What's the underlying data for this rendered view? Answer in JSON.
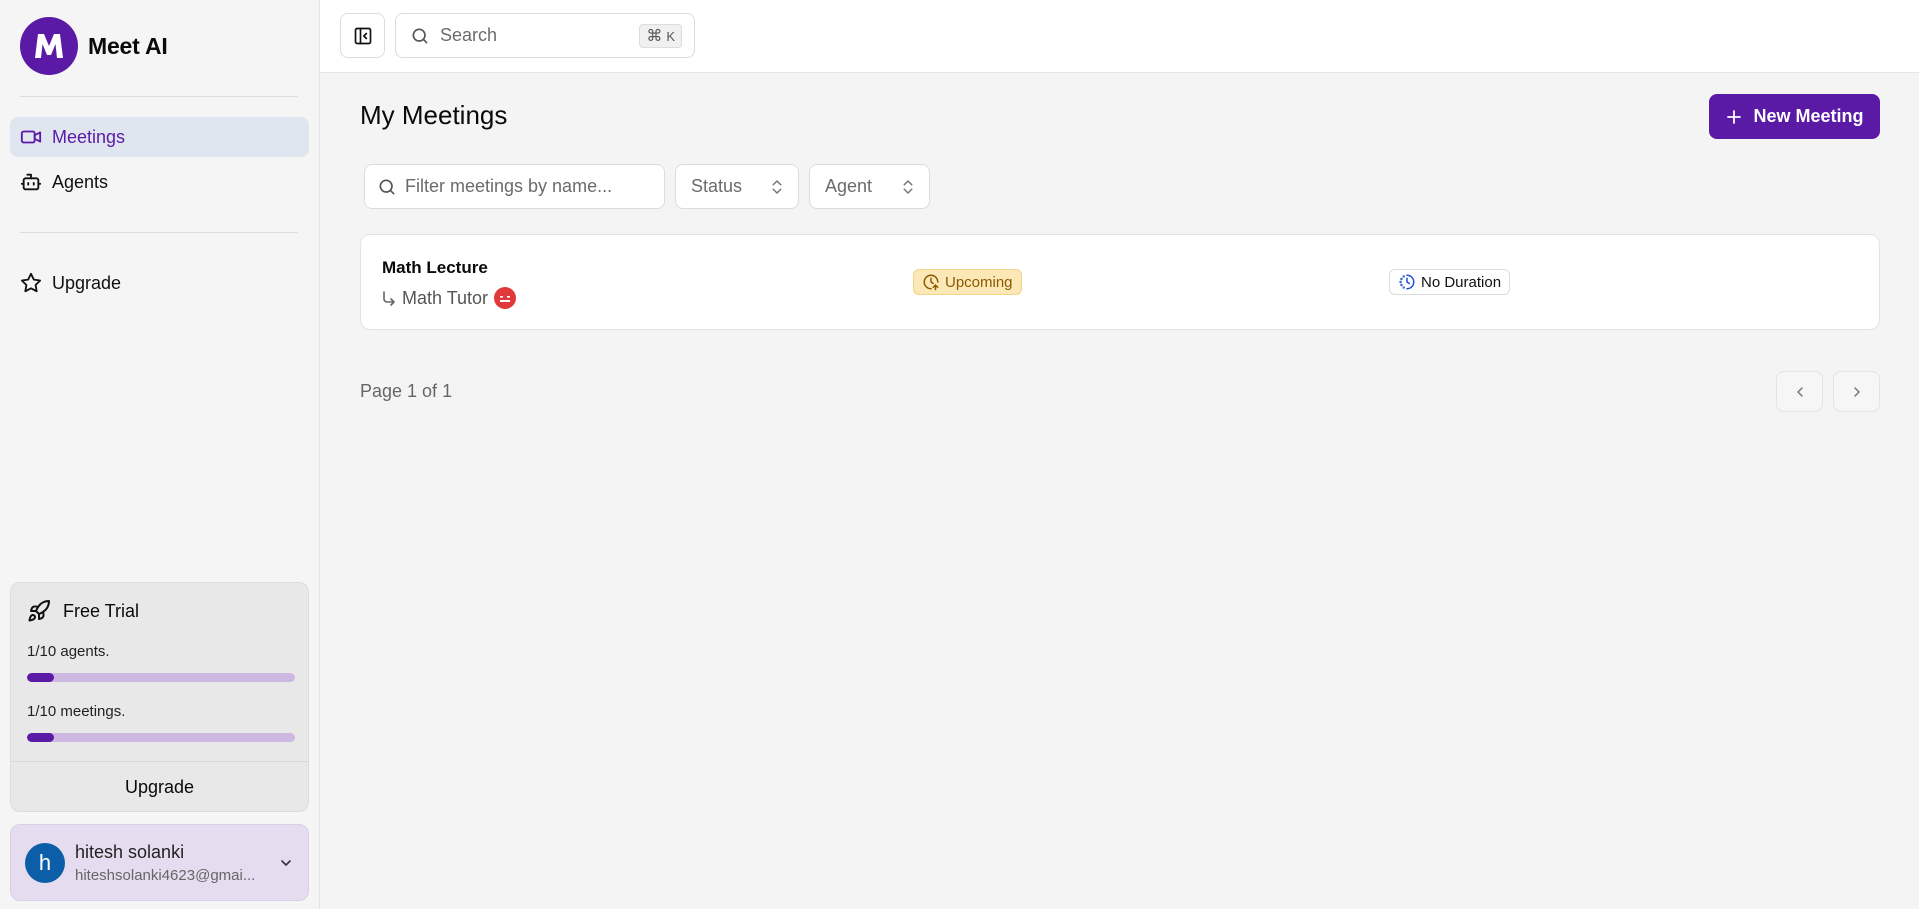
{
  "brand": {
    "name": "Meet AI",
    "logo_letter": "M"
  },
  "nav": {
    "items": [
      {
        "label": "Meetings",
        "icon": "video-icon",
        "active": true
      },
      {
        "label": "Agents",
        "icon": "bot-icon",
        "active": false
      }
    ],
    "upgrade_label": "Upgrade"
  },
  "trial": {
    "title": "Free Trial",
    "agents_label": "1/10 agents.",
    "agents_progress": 0.1,
    "meetings_label": "1/10 meetings.",
    "meetings_progress": 0.1,
    "upgrade_label": "Upgrade"
  },
  "user": {
    "initial": "h",
    "name": "hitesh solanki",
    "email": "hiteshsolanki4623@gmai..."
  },
  "topbar": {
    "search_placeholder": "Search",
    "shortcut_symbol": "⌘",
    "shortcut_key": "K"
  },
  "main": {
    "title": "My Meetings",
    "new_button_label": "New Meeting",
    "filters": {
      "search_placeholder": "Filter meetings by name...",
      "status_label": "Status",
      "agent_label": "Agent"
    },
    "meetings": [
      {
        "name": "Math Lecture",
        "agent": "Math Tutor",
        "status": "Upcoming",
        "duration": "No Duration"
      }
    ],
    "pagination": {
      "text": "Page 1 of 1"
    }
  },
  "colors": {
    "brand": "#5b1aa6",
    "active_nav_bg": "#dfe6f0",
    "upcoming_bg": "#fce7b6",
    "upcoming_text": "#8a5a00"
  }
}
